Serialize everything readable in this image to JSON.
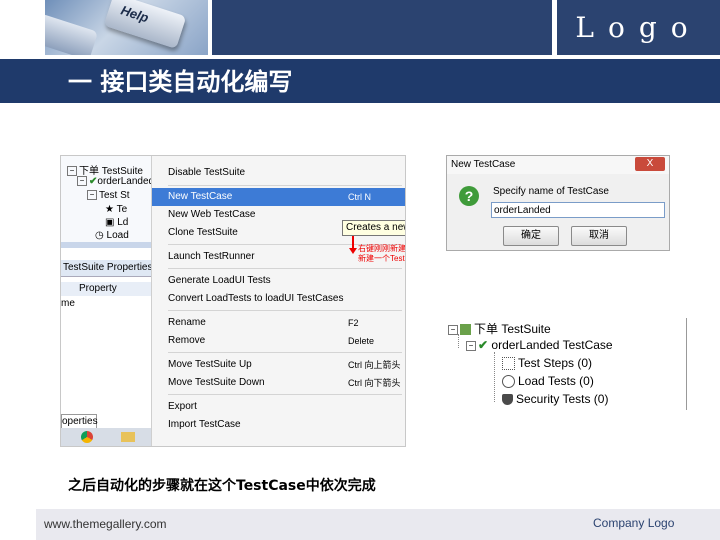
{
  "header": {
    "logo": "Logo",
    "key_label": "Help",
    "title": "一 接口类自动化编写"
  },
  "left_shot": {
    "tree": [
      "下单 TestSuite",
      "orderLanded",
      "Test St",
      "Te",
      "Ld",
      "Load"
    ],
    "props_tab": "TestSuite Properties",
    "props_header": "Property",
    "props_row": "me",
    "bottom_tab": "operties",
    "menu": {
      "items": [
        {
          "label": "Disable TestSuite",
          "shortcut": ""
        },
        {
          "label": "New TestCase",
          "shortcut": "Ctrl N",
          "highlight": true
        },
        {
          "label": "New Web TestCase",
          "shortcut": ""
        },
        {
          "label": "Clone TestSuite",
          "shortcut": ""
        },
        {
          "label": "Launch TestRunner",
          "shortcut": ""
        },
        {
          "label": "Generate LoadUI Tests",
          "shortcut": ""
        },
        {
          "label": "Convert LoadTests to loadUI TestCases",
          "shortcut": ""
        },
        {
          "label": "Rename",
          "shortcut": "F2"
        },
        {
          "label": "Remove",
          "shortcut": "Delete"
        },
        {
          "label": "Move TestSuite Up",
          "shortcut": "Ctrl 向上箭头"
        },
        {
          "label": "Move TestSuite Down",
          "shortcut": "Ctrl 向下箭头"
        },
        {
          "label": "Export",
          "shortcut": ""
        },
        {
          "label": "Import TestCase",
          "shortcut": ""
        }
      ],
      "tooltip": "Creates a new TestCase in this TestSuite",
      "annotation_line1": "右键刚刚新建的TestSuite",
      "annotation_line2": "新建一个TestCase"
    }
  },
  "dialog": {
    "title": "New TestCase",
    "close": "X",
    "help_icon": "?",
    "label": "Specify name of TestCase",
    "value": "orderLanded",
    "ok": "确定",
    "cancel": "取消"
  },
  "tree_right": {
    "suite": "下单 TestSuite",
    "case": "orderLanded TestCase",
    "children": [
      "Test Steps (0)",
      "Load Tests (0)",
      "Security Tests (0)"
    ]
  },
  "caption": "之后自动化的步骤就在这个TestCase中依次完成",
  "footer": {
    "left": "www.themegallery.com",
    "right": "Company Logo"
  },
  "colors": {
    "brand": "#2b4370",
    "band": "#1f3a6b",
    "highlight": "#3d7bd6",
    "annotation": "#ee0000"
  }
}
